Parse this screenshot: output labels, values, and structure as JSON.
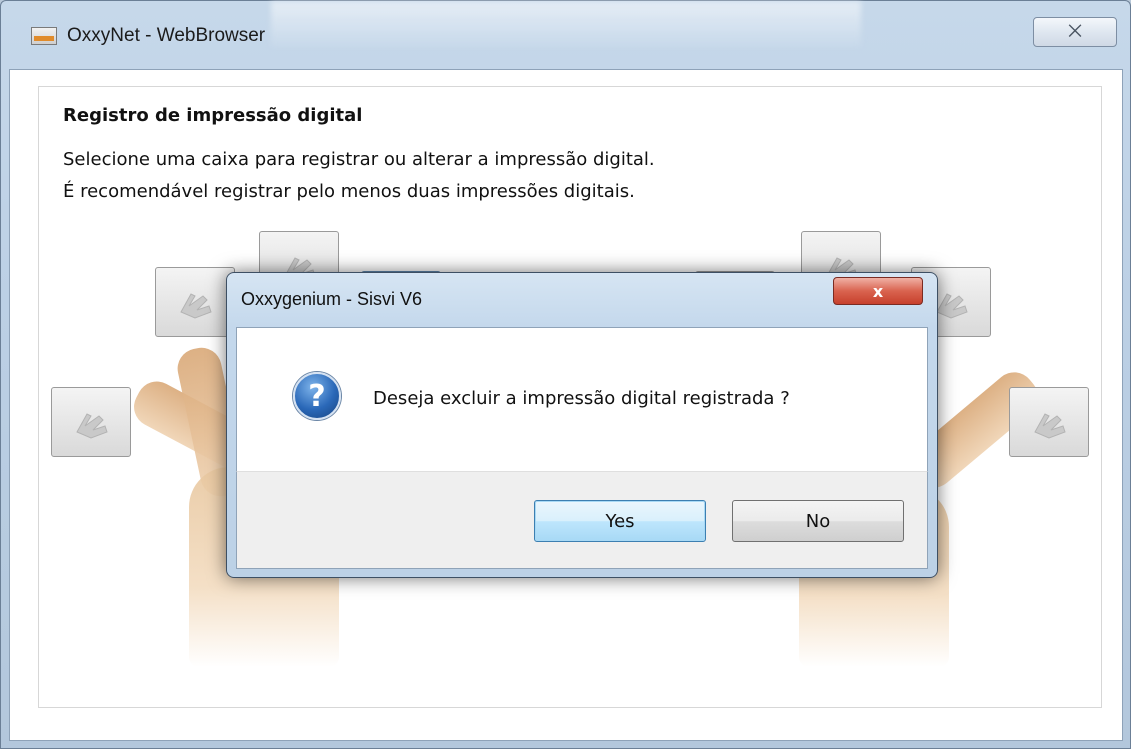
{
  "outer_window": {
    "title": "OxxyNet - WebBrowser",
    "close_glyph": "⨉"
  },
  "page": {
    "heading": "Registro de impressão digital",
    "instruction_1": "Selecione uma caixa para registrar ou alterar a impressão digital.",
    "instruction_2": "É recomendável registrar pelo menos duas impressões digitais."
  },
  "fingers": {
    "icon": "fingerprint-hand-icon",
    "count": 10
  },
  "dialog": {
    "title": "Oxxygenium - Sisvi V6",
    "close_glyph": "x",
    "icon": "question-icon",
    "icon_glyph": "?",
    "message": "Deseja excluir a impressão digital registrada ?",
    "yes_label": "Yes",
    "no_label": "No"
  },
  "colors": {
    "dialog_close_red": "#c7402c",
    "default_button_blue": "#3c7fb1"
  }
}
